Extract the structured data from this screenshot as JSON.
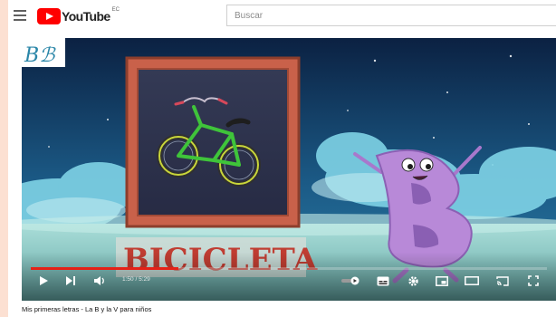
{
  "header": {
    "logo_text": "YouTube",
    "logo_country": "EC",
    "search_placeholder": "Buscar"
  },
  "video": {
    "corner_caption": "Bℬ",
    "word_caption": "BICICLETA",
    "progress": 0.2864,
    "time_display": "1:50 / 5:29",
    "title": "Mis primeras letras - La B y la V para niños"
  },
  "colors": {
    "accent": "#e52117",
    "sky": "#0e2647",
    "frame": "#c9614a",
    "letter": "#b889d8"
  },
  "icons": [
    "menu-icon",
    "youtube-logo-icon",
    "play-icon",
    "next-icon",
    "volume-icon",
    "autoplay-toggle-icon",
    "subtitles-icon",
    "settings-icon",
    "miniplayer-icon",
    "theater-icon",
    "cast-icon",
    "fullscreen-icon"
  ]
}
